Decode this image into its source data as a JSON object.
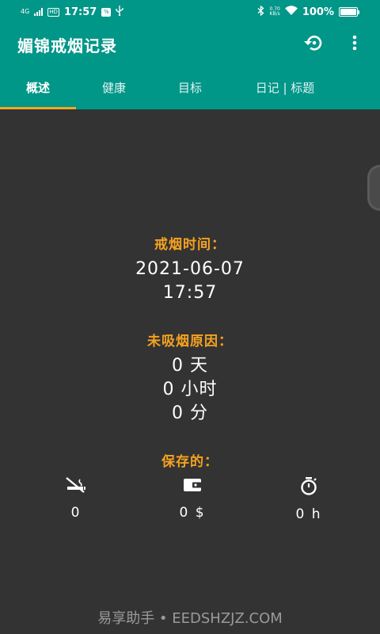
{
  "status_bar": {
    "network": "4G",
    "hd": "HD",
    "time": "17:57",
    "badge": "%",
    "speed_value": "0.70",
    "speed_unit": "KB/s",
    "battery": "100%"
  },
  "app": {
    "title": "媚锦戒烟记录",
    "actions": [
      {
        "icon": "reset-icon"
      },
      {
        "icon": "more-vert-icon"
      }
    ]
  },
  "tabs": [
    {
      "label": "概述",
      "active": true
    },
    {
      "label": "健康",
      "active": false
    },
    {
      "label": "目标",
      "active": false
    },
    {
      "label": "日记 | 标题",
      "active": false
    }
  ],
  "quit_time": {
    "label": "戒烟时间：",
    "date": "2021-06-07",
    "time": "17:57"
  },
  "not_smoked": {
    "label": "未吸烟原因：",
    "days": "0 天",
    "hours": "0 小时",
    "minutes": "0 分"
  },
  "saved": {
    "label": "保存的：",
    "items": [
      {
        "icon": "no-smoking-icon",
        "value": "0"
      },
      {
        "icon": "wallet-icon",
        "value": "0 $"
      },
      {
        "icon": "stopwatch-icon",
        "value": "0 h"
      }
    ]
  },
  "watermark": "易享助手 • EEDSHZJZ.COM",
  "colors": {
    "primary": "#009688",
    "accent": "#f5a21f",
    "background": "#333333",
    "indicator": "#f5a623"
  }
}
